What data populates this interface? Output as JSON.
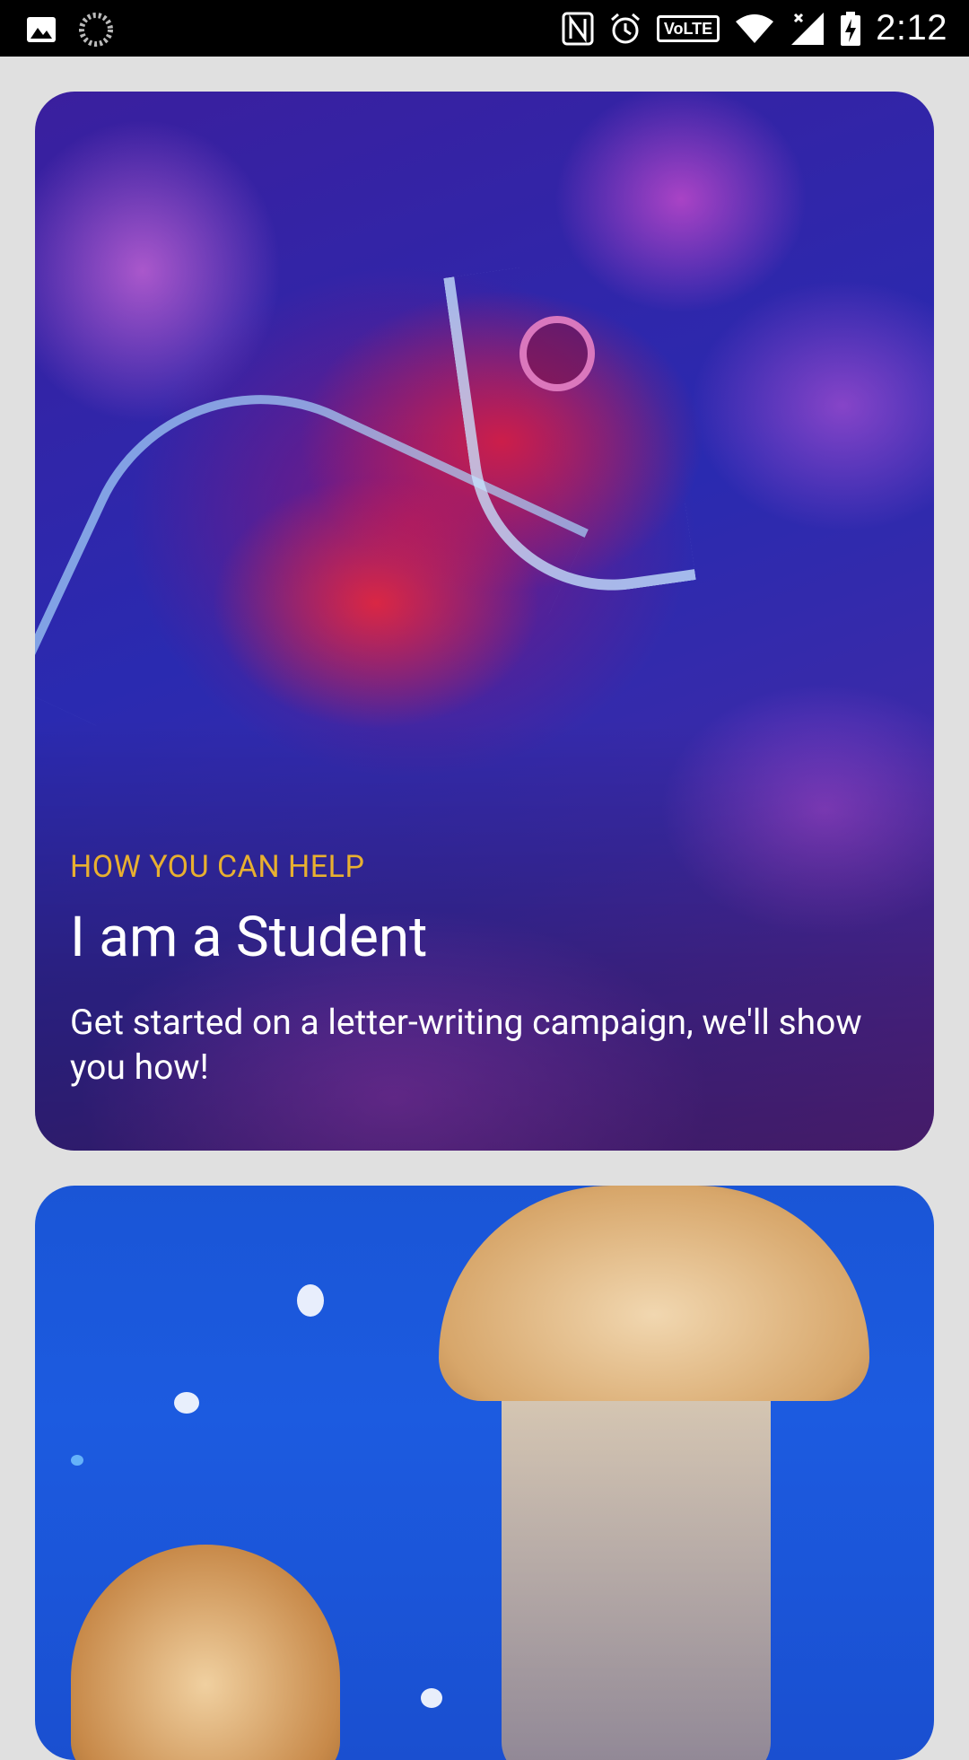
{
  "status_bar": {
    "time": "2:12",
    "volte": "VoLTE",
    "icons_left": [
      "gallery-icon",
      "loading-icon"
    ],
    "icons_right": [
      "nfc-icon",
      "alarm-icon",
      "volte-icon",
      "wifi-icon",
      "signal-icon",
      "battery-icon"
    ]
  },
  "cards": [
    {
      "eyebrow": "HOW YOU CAN HELP",
      "title": "I am a Student",
      "description": "Get started on a letter-writing campaign, we'll show you how!",
      "image": "fish-image"
    },
    {
      "image": "jellyfish-image"
    }
  ],
  "colors": {
    "eyebrow": "#e8b030",
    "background": "#e0e0e0",
    "status_bar": "#000000"
  }
}
